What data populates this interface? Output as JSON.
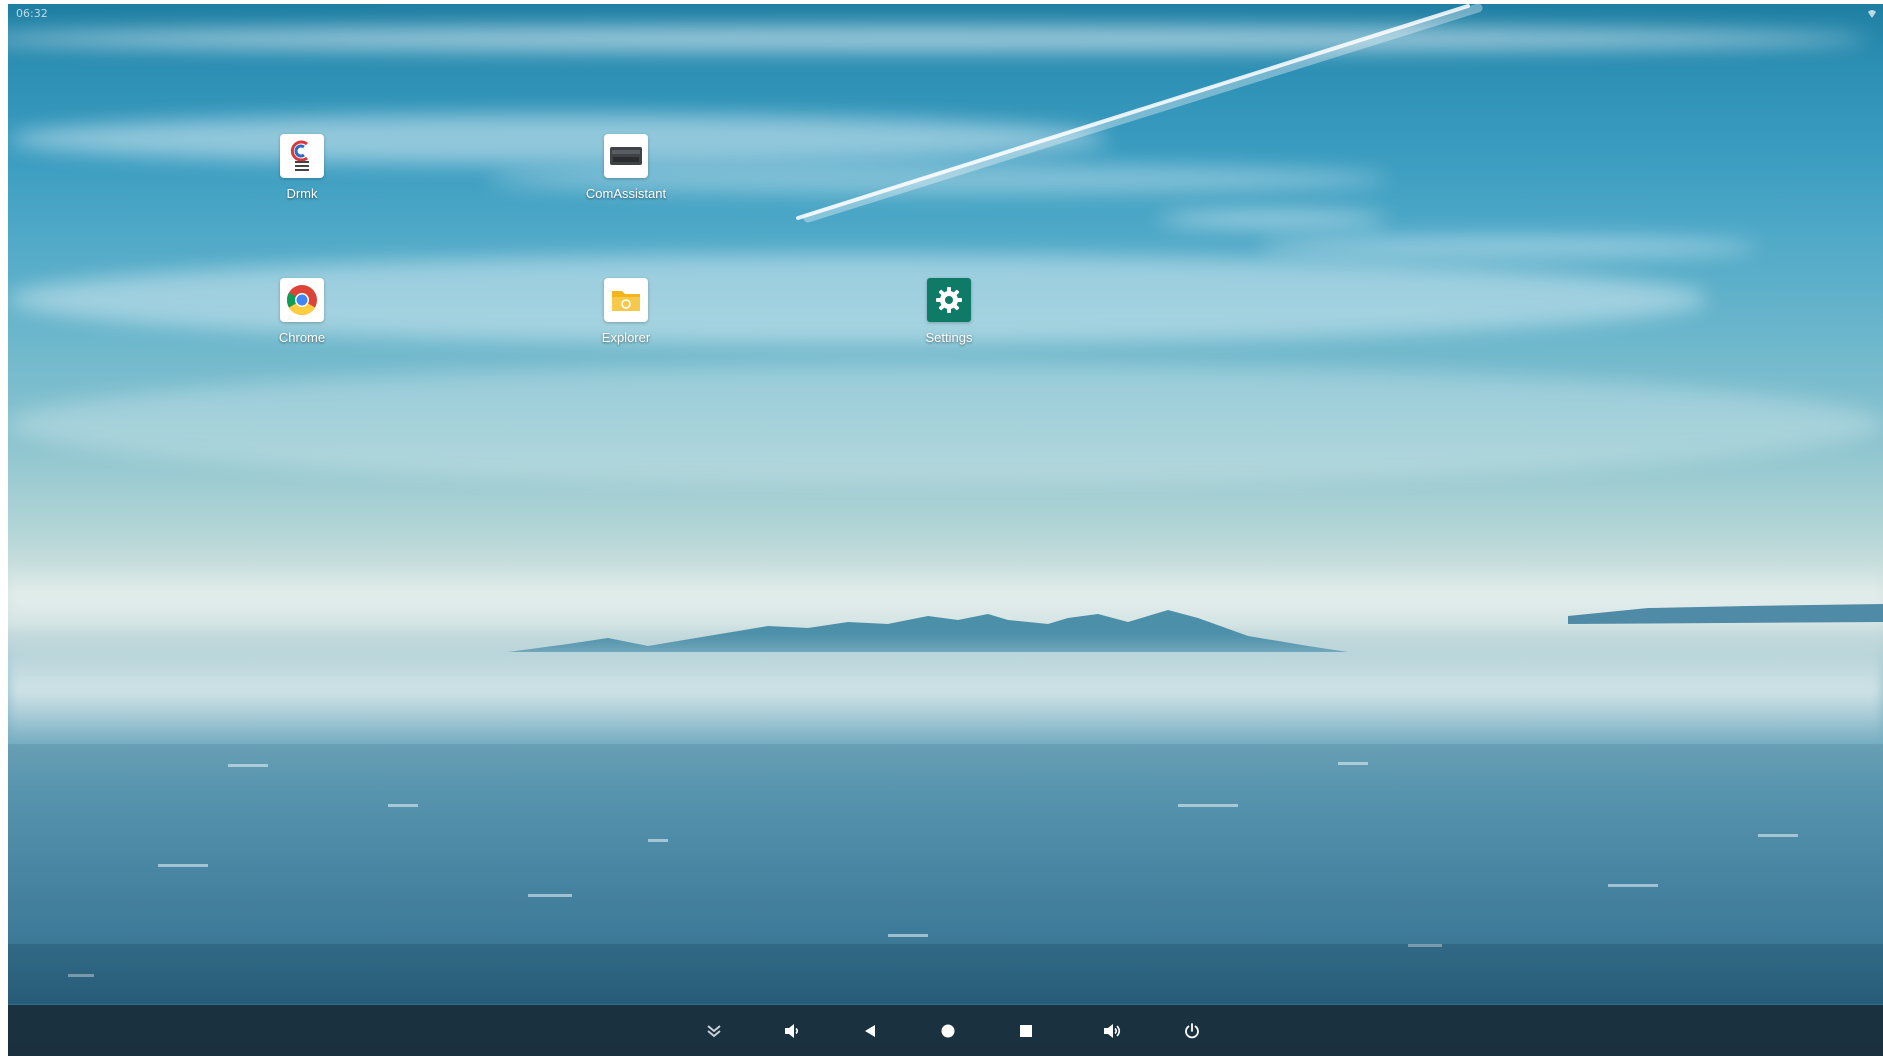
{
  "status_bar": {
    "time": "06:32",
    "wifi_icon": "wifi-icon"
  },
  "apps": [
    {
      "label": "Drmk",
      "icon": "drmk-app-icon"
    },
    {
      "label": "ComAssistant",
      "icon": "comassistant-app-icon"
    },
    {
      "label": "Chrome",
      "icon": "chrome-icon"
    },
    {
      "label": "Explorer",
      "icon": "explorer-folder-icon"
    },
    {
      "label": "Settings",
      "icon": "settings-gear-icon"
    }
  ],
  "navbar": {
    "buttons": [
      {
        "name": "collapse",
        "icon": "chevron-double-down-icon"
      },
      {
        "name": "volume-down",
        "icon": "volume-down-icon"
      },
      {
        "name": "back",
        "icon": "back-triangle-icon"
      },
      {
        "name": "home",
        "icon": "home-circle-icon"
      },
      {
        "name": "recents",
        "icon": "recents-square-icon"
      },
      {
        "name": "volume-up",
        "icon": "volume-up-icon"
      },
      {
        "name": "power",
        "icon": "power-icon"
      }
    ]
  },
  "colors": {
    "sky_top": "#1f7fa3",
    "horizon": "#d8e5e2",
    "navbar": "#192d3a",
    "settings_tile": "#0f7a66",
    "explorer_folder": "#f2b619"
  }
}
